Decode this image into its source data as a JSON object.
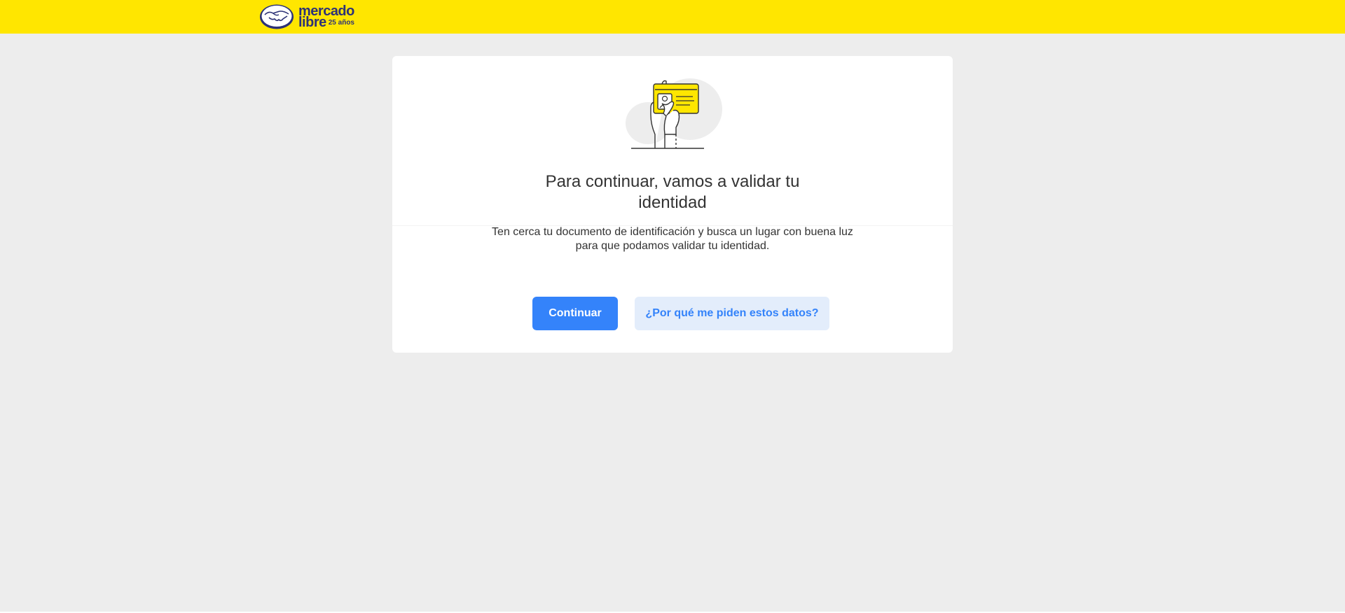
{
  "header": {
    "logo": {
      "word1": "mercado",
      "word2": "libre",
      "badge": "25 años"
    },
    "brand_color": "#ffe600"
  },
  "card": {
    "illustration": "hand-holding-id-card-illustration",
    "title": "Para continuar, vamos a validar tu identidad",
    "description": "Ten cerca tu documento de identificación y busca un lugar con buena luz para que podamos validar tu identidad.",
    "primary_button": "Continuar",
    "secondary_button": "¿Por qué me piden estos datos?"
  },
  "colors": {
    "accent": "#3483fa",
    "accent_light": "#e3edfb",
    "background": "#ededed",
    "logo_navy": "#2d3277"
  }
}
